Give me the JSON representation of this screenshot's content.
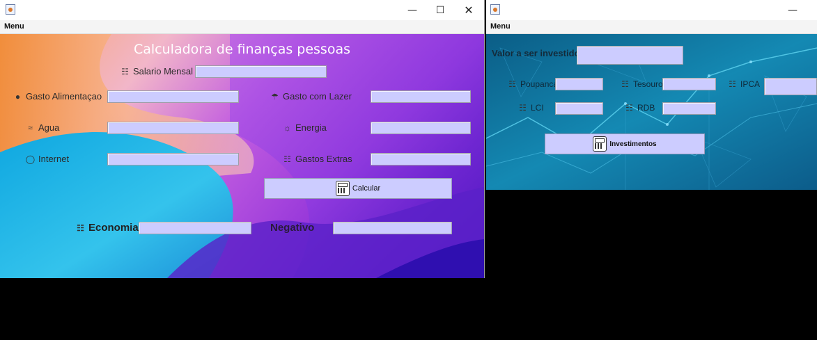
{
  "colors": {
    "field": "#ccccff",
    "title": "#ffffff"
  },
  "window1": {
    "menu": "Menu",
    "title": "Calculadora de finanças pessoas",
    "fields": {
      "salario": "Salario Mensal",
      "alimentacao": "Gasto Alimentaçao",
      "lazer": "Gasto com Lazer",
      "agua": "Agua",
      "energia": "Energia",
      "internet": "Internet",
      "extras": "Gastos Extras"
    },
    "calcular": "Calcular",
    "economia": "Economia",
    "negativo": "Negativo"
  },
  "window2": {
    "menu": "Menu",
    "valor": "Valor a ser investido",
    "poupanca": "Poupanca",
    "tesouro": "Tesouro",
    "ipca": "IPCA",
    "lci": "LCI",
    "rdb": "RDB",
    "investimentos": "Investimentos"
  }
}
